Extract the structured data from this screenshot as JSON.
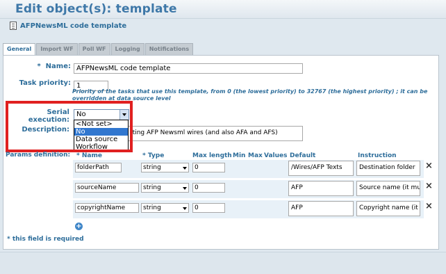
{
  "page": {
    "title": "Edit object(s): template",
    "subtitle": "AFPNewsML code template"
  },
  "tabs": [
    {
      "label": "General"
    },
    {
      "label": "Import WF"
    },
    {
      "label": "Poll WF"
    },
    {
      "label": "Logging"
    },
    {
      "label": "Notifications"
    }
  ],
  "form": {
    "name_label": "Name:",
    "name_value": "AFPNewsML code template",
    "task_priority_label": "Task priority:",
    "task_priority_value": "1",
    "task_priority_help": "Priority of the tasks that use this template, from 0 (the lowest priority) to 32767 (the highest priority) ; it can be overridden at data source level",
    "serial_execution_label": "Serial execution:",
    "serial_execution_value": "No",
    "serial_execution_options": [
      "<Not set>",
      "No",
      "Data source",
      "Workflow"
    ],
    "description_label": "Description:",
    "description_value": "Template for converting AFP Newsml wires (and also AFA and AFS)",
    "description_visible": "rting AFP Newsml wires (and also AFA and AFS)",
    "params_label": "Params definition:",
    "required_marker": "*",
    "required_note": "* this field is required"
  },
  "params": {
    "headers": {
      "name": "* Name",
      "type": "* Type",
      "max_length": "Max length",
      "min": "Min",
      "max": "Max",
      "values": "Values",
      "default": "Default",
      "instruction": "Instruction"
    },
    "rows": [
      {
        "name": "folderPath",
        "type": "string",
        "max_length": "0",
        "default": "/Wires/AFP Texts",
        "instruction": "Destination folder"
      },
      {
        "name": "sourceName",
        "type": "string",
        "max_length": "0",
        "default": "AFP",
        "instruction": "Source name (it mu"
      },
      {
        "name": "copyrightName",
        "type": "string",
        "max_length": "0",
        "default": "AFP",
        "instruction": "Copyright name (it"
      }
    ]
  },
  "icons": {
    "delete": "×",
    "add": "+"
  }
}
